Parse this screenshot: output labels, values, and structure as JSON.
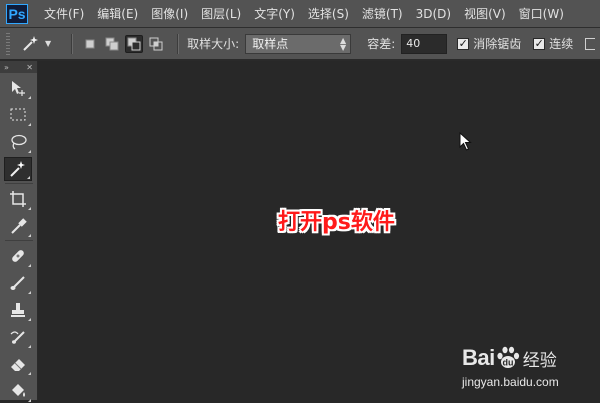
{
  "app": {
    "logo_text": "Ps",
    "brand_color": "#31a8ff"
  },
  "menu": {
    "items": [
      "文件(F)",
      "编辑(E)",
      "图像(I)",
      "图层(L)",
      "文字(Y)",
      "选择(S)",
      "滤镜(T)",
      "3D(D)",
      "视图(V)",
      "窗口(W)"
    ]
  },
  "options": {
    "sample_size_label": "取样大小:",
    "sample_size_value": "取样点",
    "tolerance_label": "容差:",
    "tolerance_value": "40",
    "anti_alias_label": "消除锯齿",
    "anti_alias_checked": true,
    "contiguous_label": "连续",
    "contiguous_checked": true
  },
  "toolbar": {
    "tools": [
      "move-tool",
      "marquee-tool",
      "lasso-tool",
      "magic-wand-tool",
      "crop-tool",
      "eyedropper-tool",
      "healing-brush-tool",
      "brush-tool",
      "clone-stamp-tool",
      "history-brush-tool",
      "eraser-tool",
      "paint-bucket-tool"
    ],
    "active_tool": "magic-wand-tool"
  },
  "canvas": {
    "caption": "打开ps软件",
    "caption_color": "#ff1a1a"
  },
  "watermark": {
    "brand": "Bai",
    "brand2": "经验",
    "url": "jingyan.baidu.com"
  }
}
